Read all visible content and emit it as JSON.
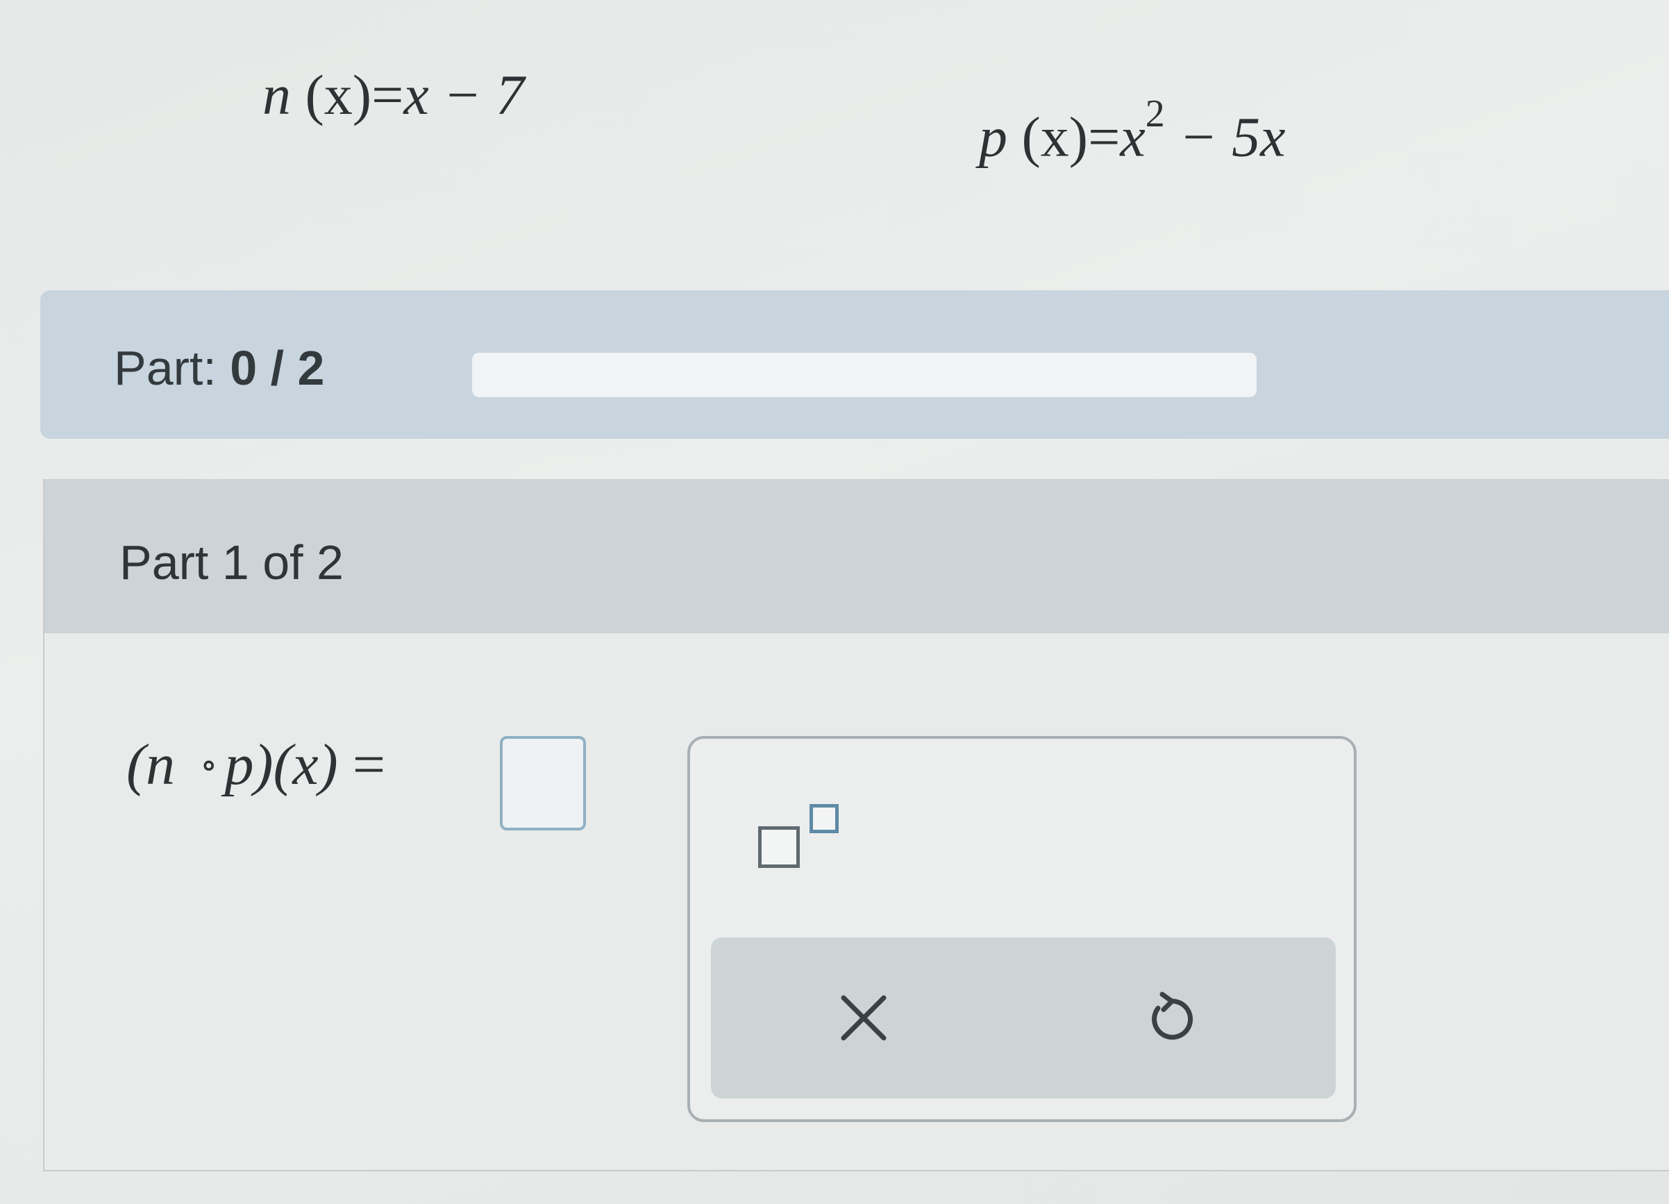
{
  "functions": {
    "n": {
      "name": "n",
      "arg": "(x)",
      "equals": "=",
      "rhs": "x − 7"
    },
    "p": {
      "name": "p",
      "arg": "(x)",
      "equals": "=",
      "rhs_base": "x",
      "rhs_exp": "2",
      "rhs_rest": " − 5x"
    }
  },
  "progress": {
    "prefix": "Part: ",
    "value_text": "0 / 2",
    "fraction": 0
  },
  "part": {
    "title": "Part 1 of 2",
    "equation": {
      "open": "(n",
      "ring": "∘",
      "rest": "p)(x)",
      "equals": " ="
    },
    "answer_value": ""
  },
  "keypad": {
    "exponent_icon": "exponent-template-icon",
    "clear_icon": "close-icon",
    "undo_icon": "undo-icon"
  },
  "colors": {
    "progress_panel": "#c8d5de",
    "part_header": "#cdd3d6",
    "answer_border": "#8fb0c4",
    "exponent_accent": "#5f8aa6"
  }
}
